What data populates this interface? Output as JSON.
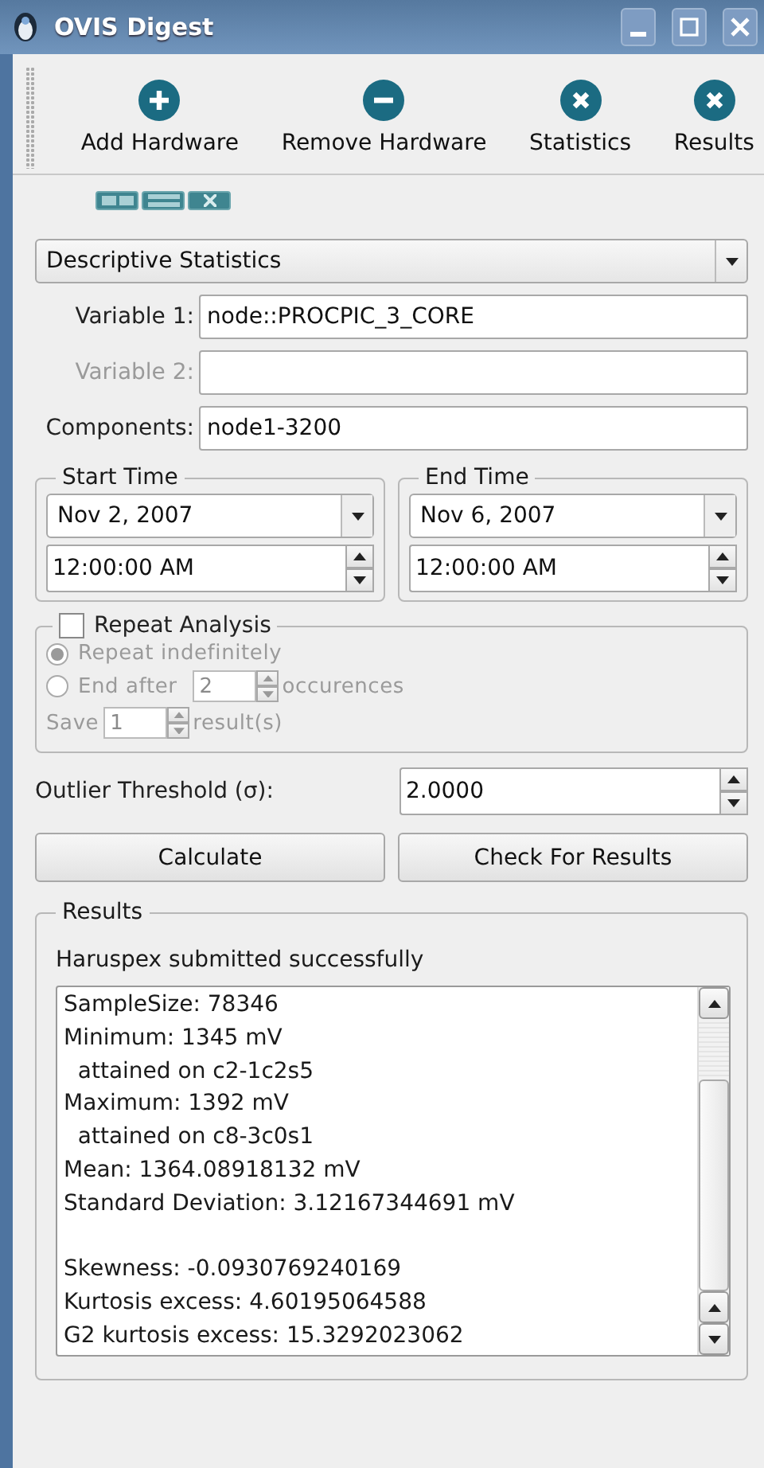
{
  "window": {
    "title": "OVIS Digest"
  },
  "toolbar": [
    {
      "label": "Add Hardware",
      "kind": "add"
    },
    {
      "label": "Remove Hardware",
      "kind": "remove"
    },
    {
      "label": "Statistics",
      "kind": "close"
    },
    {
      "label": "Results",
      "kind": "close"
    }
  ],
  "analysis": {
    "value": "Descriptive Statistics"
  },
  "fields": [
    {
      "label": "Variable 1:",
      "value": "node::PROCPIC_3_CORE",
      "disabled": false
    },
    {
      "label": "Variable 2:",
      "disabled": true
    },
    {
      "label": "Components:",
      "value": "node1-3200",
      "disabled": false
    }
  ],
  "times": [
    {
      "title": "Start Time",
      "date": "Nov 2, 2007",
      "time": "12:00:00 AM"
    },
    {
      "title": "End Time",
      "date": "Nov 6, 2007",
      "time": "12:00:00 AM"
    }
  ],
  "repeat": {
    "label": "Repeat Analysis",
    "checked": false,
    "disabled": true,
    "options": [
      {
        "label": "Repeat indefinitely",
        "selected": true
      },
      {
        "label": "End after",
        "selected": false,
        "value": "2",
        "suffix": "occurences"
      }
    ],
    "save": {
      "label": "Save",
      "value": "1",
      "suffix": "result(s)"
    }
  },
  "outlier": {
    "label": "Outlier Threshold (σ):",
    "value": "2.0000"
  },
  "buttons": [
    "Calculate",
    "Check For Results"
  ],
  "results": {
    "title": "Results",
    "message": "Haruspex submitted successfully",
    "paragraphs": [
      [
        "SampleSize: 78346",
        "Minimum: 1345 mV",
        "  attained on c2-1c2s5",
        "Maximum: 1392 mV",
        "  attained on c8-3c0s1",
        "Mean: 1364.08918132 mV",
        "Standard Deviation: 3.12167344691 mV"
      ],
      [
        "Skewness: -0.0930769240169",
        "Kurtosis excess: 4.60195064588",
        "G2 kurtosis excess: 15.3292023062"
      ]
    ]
  }
}
